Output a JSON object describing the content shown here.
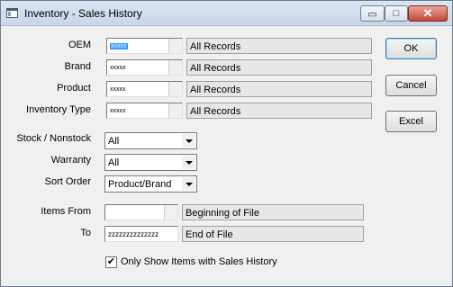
{
  "window": {
    "title": "Inventory - Sales History",
    "controls": {
      "minimize": "▭",
      "maximize": "□",
      "close": "✕"
    }
  },
  "filters": [
    {
      "label": "OEM",
      "code": "xxxxx",
      "selected": true,
      "description": "All Records"
    },
    {
      "label": "Brand",
      "code": "xxxxx",
      "selected": false,
      "description": "All Records"
    },
    {
      "label": "Product",
      "code": "xxxxx",
      "selected": false,
      "description": "All Records"
    },
    {
      "label": "Inventory Type",
      "code": "xxxxx",
      "selected": false,
      "description": "All Records"
    }
  ],
  "selects": {
    "stock": {
      "label": "Stock / Nonstock",
      "value": "All"
    },
    "warranty": {
      "label": "Warranty",
      "value": "All"
    },
    "sort": {
      "label": "Sort Order",
      "value": "Product/Brand"
    }
  },
  "range": {
    "from": {
      "label": "Items From",
      "value": "",
      "description": "Beginning of File"
    },
    "to": {
      "label": "To",
      "value": "zzzzzzzzzzzzzz",
      "description": "End of File"
    }
  },
  "buttons": {
    "ok": "OK",
    "cancel": "Cancel",
    "excel": "Excel"
  },
  "option": {
    "label": "Only Show Items with Sales History",
    "checked": true,
    "mark": "✔"
  },
  "colors": {
    "selection": "#3399ff",
    "title_bar": "#c8d6e6",
    "close_button": "#c4493a"
  }
}
